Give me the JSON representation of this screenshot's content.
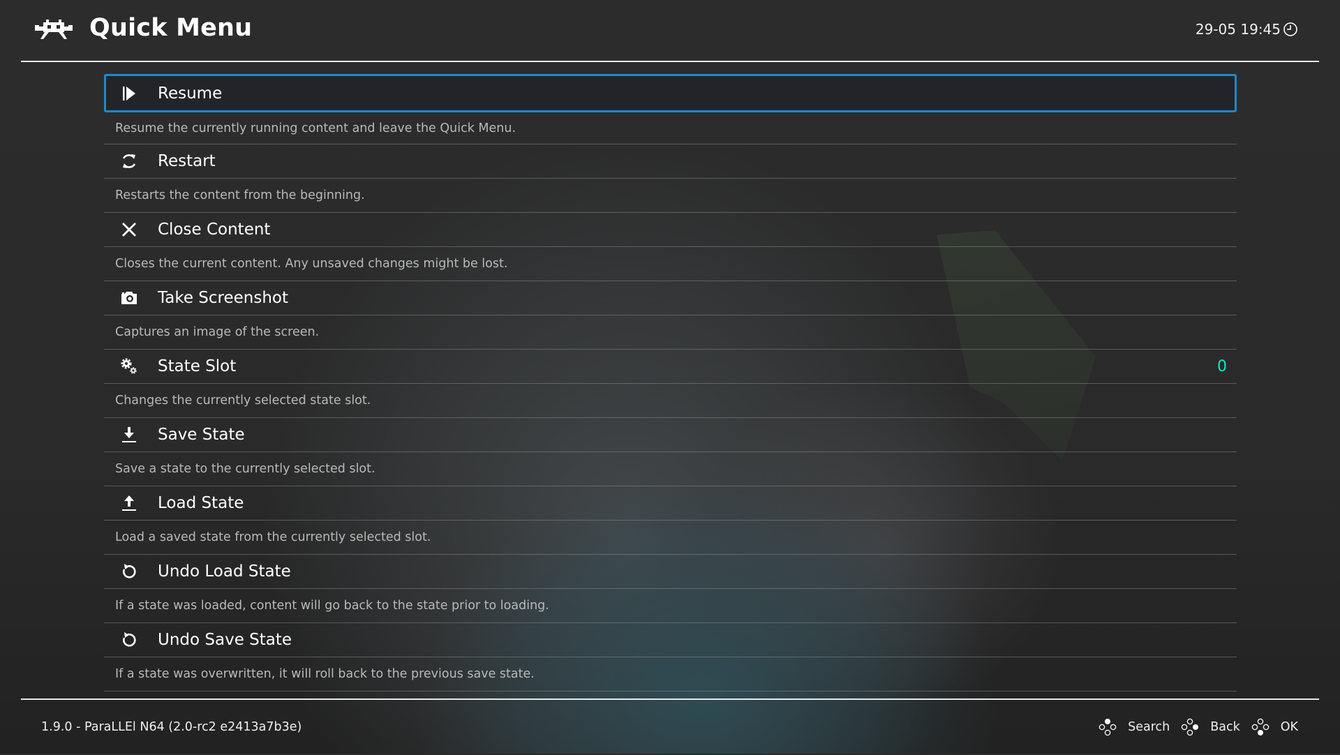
{
  "header": {
    "title": "Quick Menu",
    "logo_icon": "retroarch-invader-logo",
    "datetime": "29-05 19:45",
    "clock_icon": "clock-icon"
  },
  "colors": {
    "selection_border": "#1f88cc",
    "selection_bg": "#232429",
    "value_accent": "#17e6c0",
    "description_text": "#b9b9b9"
  },
  "menu": {
    "selected_index": 0,
    "items": [
      {
        "icon": "resume-icon",
        "label": "Resume",
        "value": "",
        "description": "Resume the currently running content and leave the Quick Menu."
      },
      {
        "icon": "restart-icon",
        "label": "Restart",
        "value": "",
        "description": "Restarts the content from the beginning."
      },
      {
        "icon": "close-icon",
        "label": "Close Content",
        "value": "",
        "description": "Closes the current content. Any unsaved changes might be lost."
      },
      {
        "icon": "camera-icon",
        "label": "Take Screenshot",
        "value": "",
        "description": "Captures an image of the screen."
      },
      {
        "icon": "gears-icon",
        "label": "State Slot",
        "value": "0",
        "description": "Changes the currently selected state slot."
      },
      {
        "icon": "download-icon",
        "label": "Save State",
        "value": "",
        "description": "Save a state to the currently selected slot."
      },
      {
        "icon": "upload-icon",
        "label": "Load State",
        "value": "",
        "description": "Load a saved state from the currently selected slot."
      },
      {
        "icon": "undo-icon",
        "label": "Undo Load State",
        "value": "",
        "description": "If a state was loaded, content will go back to the state prior to loading."
      },
      {
        "icon": "undo-icon",
        "label": "Undo Save State",
        "value": "",
        "description": "If a state was overwritten, it will roll back to the previous save state."
      }
    ]
  },
  "footer": {
    "version": "1.9.0 - ParaLLEl N64 (2.0-rc2 e2413a7b3e)",
    "hints": [
      {
        "icon": "gamepad-top-button-icon",
        "label": "Search"
      },
      {
        "icon": "gamepad-right-button-icon",
        "label": "Back"
      },
      {
        "icon": "gamepad-bottom-button-icon",
        "label": "OK"
      }
    ]
  }
}
